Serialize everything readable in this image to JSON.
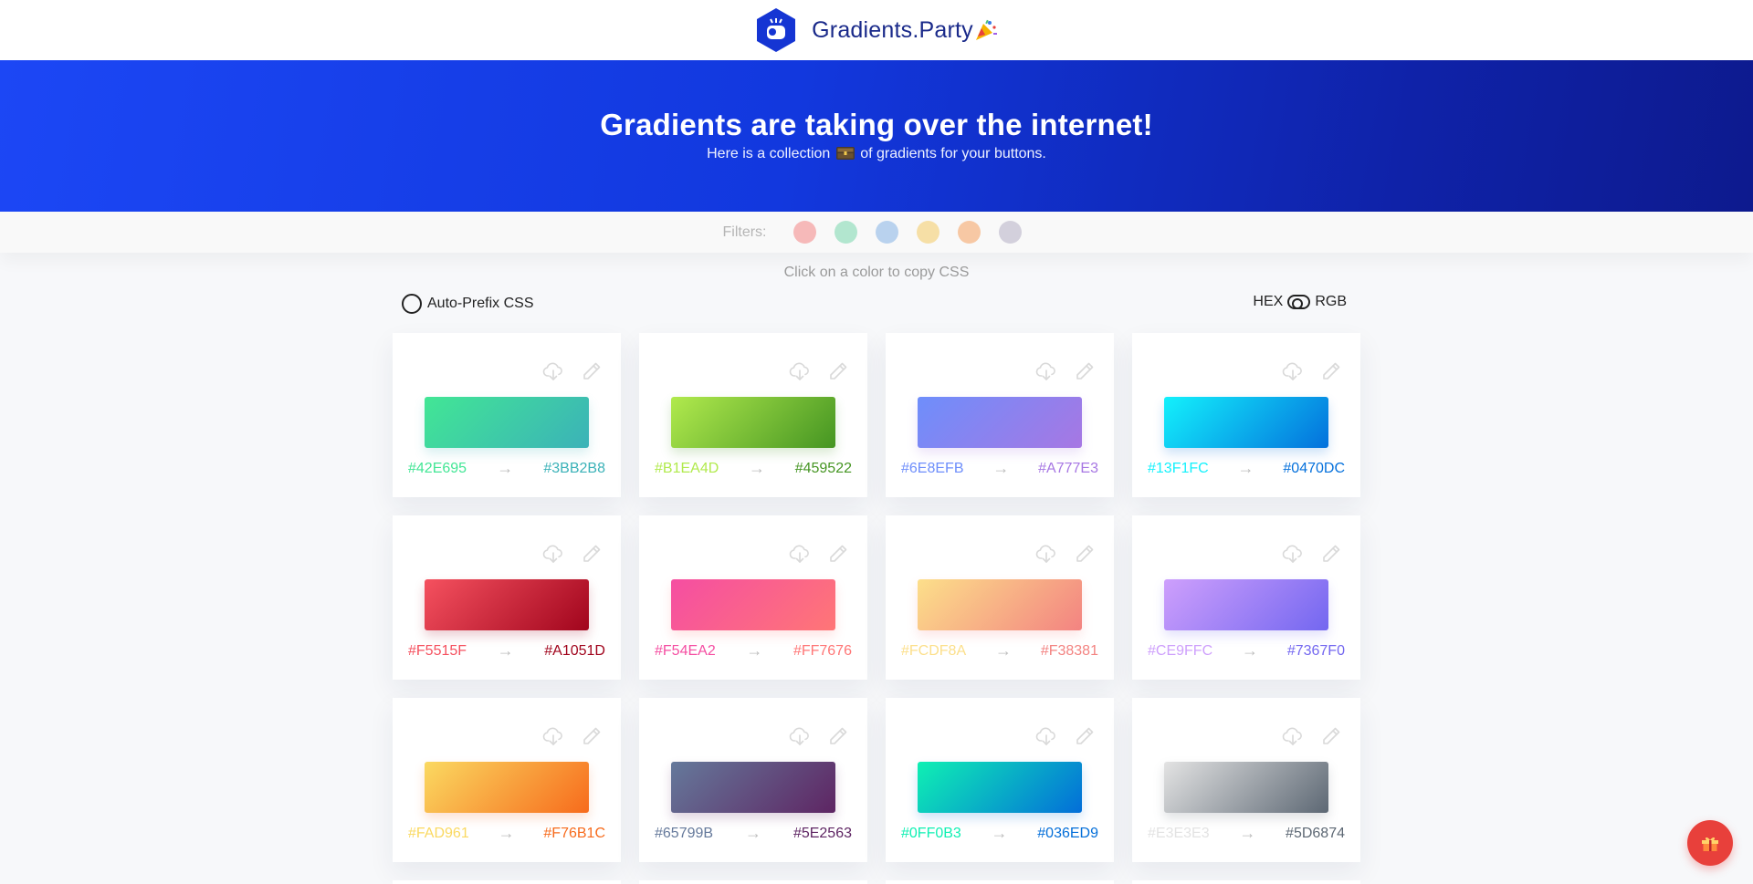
{
  "header": {
    "brand": "Gradients.Party",
    "logo_icon": "party-tv-hexagon-icon",
    "party_icon": "party-popper-icon"
  },
  "hero": {
    "title": "Gradients are taking over the internet!",
    "subtitle_before": "Here is a collection",
    "subtitle_icon": "treasure-chest-icon",
    "subtitle_after": "of gradients for your buttons."
  },
  "filters": {
    "label": "Filters:",
    "colors": [
      "#f6b9b9",
      "#b2e6cf",
      "#b9d2ee",
      "#f6dfa6",
      "#f7c8a4",
      "#d3d0dc"
    ]
  },
  "hint": "Click on a color to copy CSS",
  "options": {
    "autoprefix_label": "Auto-Prefix CSS",
    "hex_label": "HEX",
    "rgb_label": "RGB"
  },
  "icons": {
    "download": "cloud-download-icon",
    "edit": "pencil-icon",
    "gift": "gift-icon"
  },
  "arrow": "→",
  "gradients": [
    {
      "from": "#42E695",
      "to": "#3BB2B8"
    },
    {
      "from": "#B1EA4D",
      "to": "#459522"
    },
    {
      "from": "#6E8EFB",
      "to": "#A777E3"
    },
    {
      "from": "#13F1FC",
      "to": "#0470DC"
    },
    {
      "from": "#F5515F",
      "to": "#A1051D"
    },
    {
      "from": "#F54EA2",
      "to": "#FF7676"
    },
    {
      "from": "#FCDF8A",
      "to": "#F38381"
    },
    {
      "from": "#CE9FFC",
      "to": "#7367F0"
    },
    {
      "from": "#FAD961",
      "to": "#F76B1C"
    },
    {
      "from": "#65799B",
      "to": "#5E2563"
    },
    {
      "from": "#0FF0B3",
      "to": "#036ED9"
    },
    {
      "from": "#E3E3E3",
      "to": "#5D6874"
    }
  ]
}
